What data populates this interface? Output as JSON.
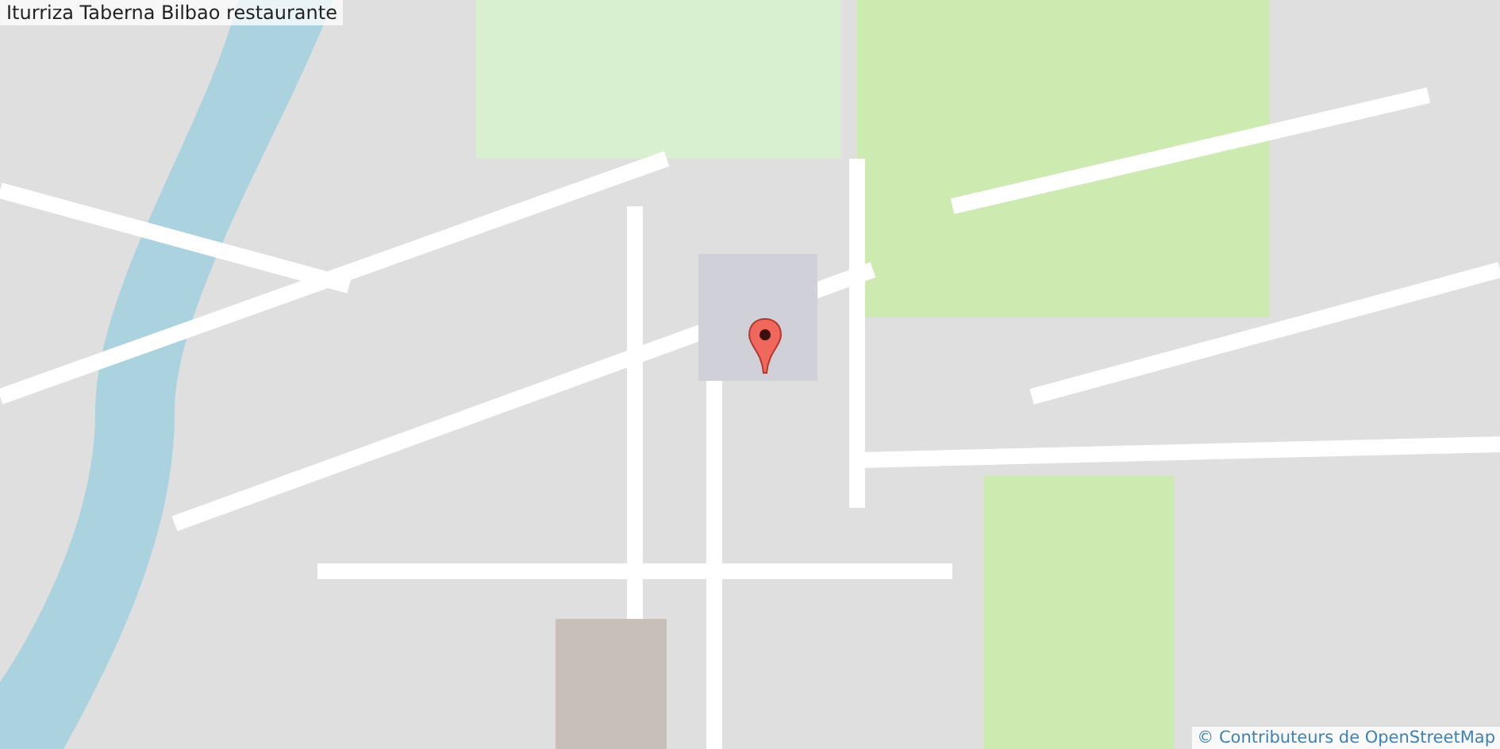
{
  "map": {
    "title": "Iturriza Taberna Bilbao restaurante",
    "attribution": "© Contributeurs de OpenStreetMap"
  }
}
